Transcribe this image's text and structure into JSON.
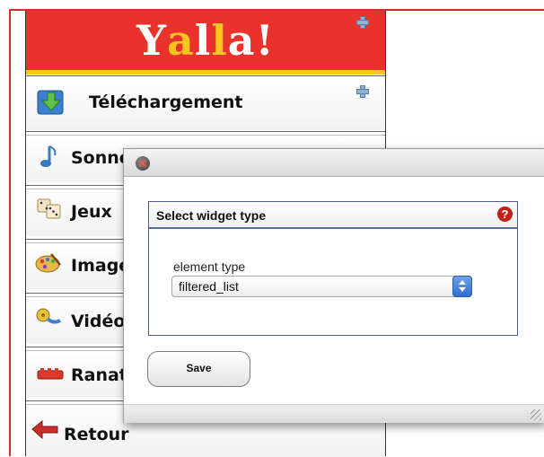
{
  "app": {
    "logo_text": "Yalla!",
    "logo_letters": [
      "Y",
      "a",
      "l",
      "l",
      "a",
      "!"
    ]
  },
  "menu": {
    "items": [
      {
        "label": "Téléchargement",
        "icon": "download-icon"
      },
      {
        "label": "Sonneries",
        "icon": "music-note-icon"
      },
      {
        "label": "Jeux",
        "icon": "dice-icon"
      },
      {
        "label": "Images",
        "icon": "paint-palette-icon"
      },
      {
        "label": "Vidéos",
        "icon": "film-reel-icon"
      },
      {
        "label": "Ranat",
        "icon": "ringtone-icon"
      },
      {
        "label": "Retour",
        "icon": "back-arrow-icon"
      }
    ]
  },
  "dialog": {
    "panel_title": "Select widget type",
    "field_label": "element type",
    "select_value": "filtered_list",
    "save_label": "Save"
  },
  "colors": {
    "header_red": "#e8322b",
    "header_stripe": "#f7c51f",
    "help_red": "#c0221b",
    "select_arrow_blue": "#2f6fd0"
  }
}
